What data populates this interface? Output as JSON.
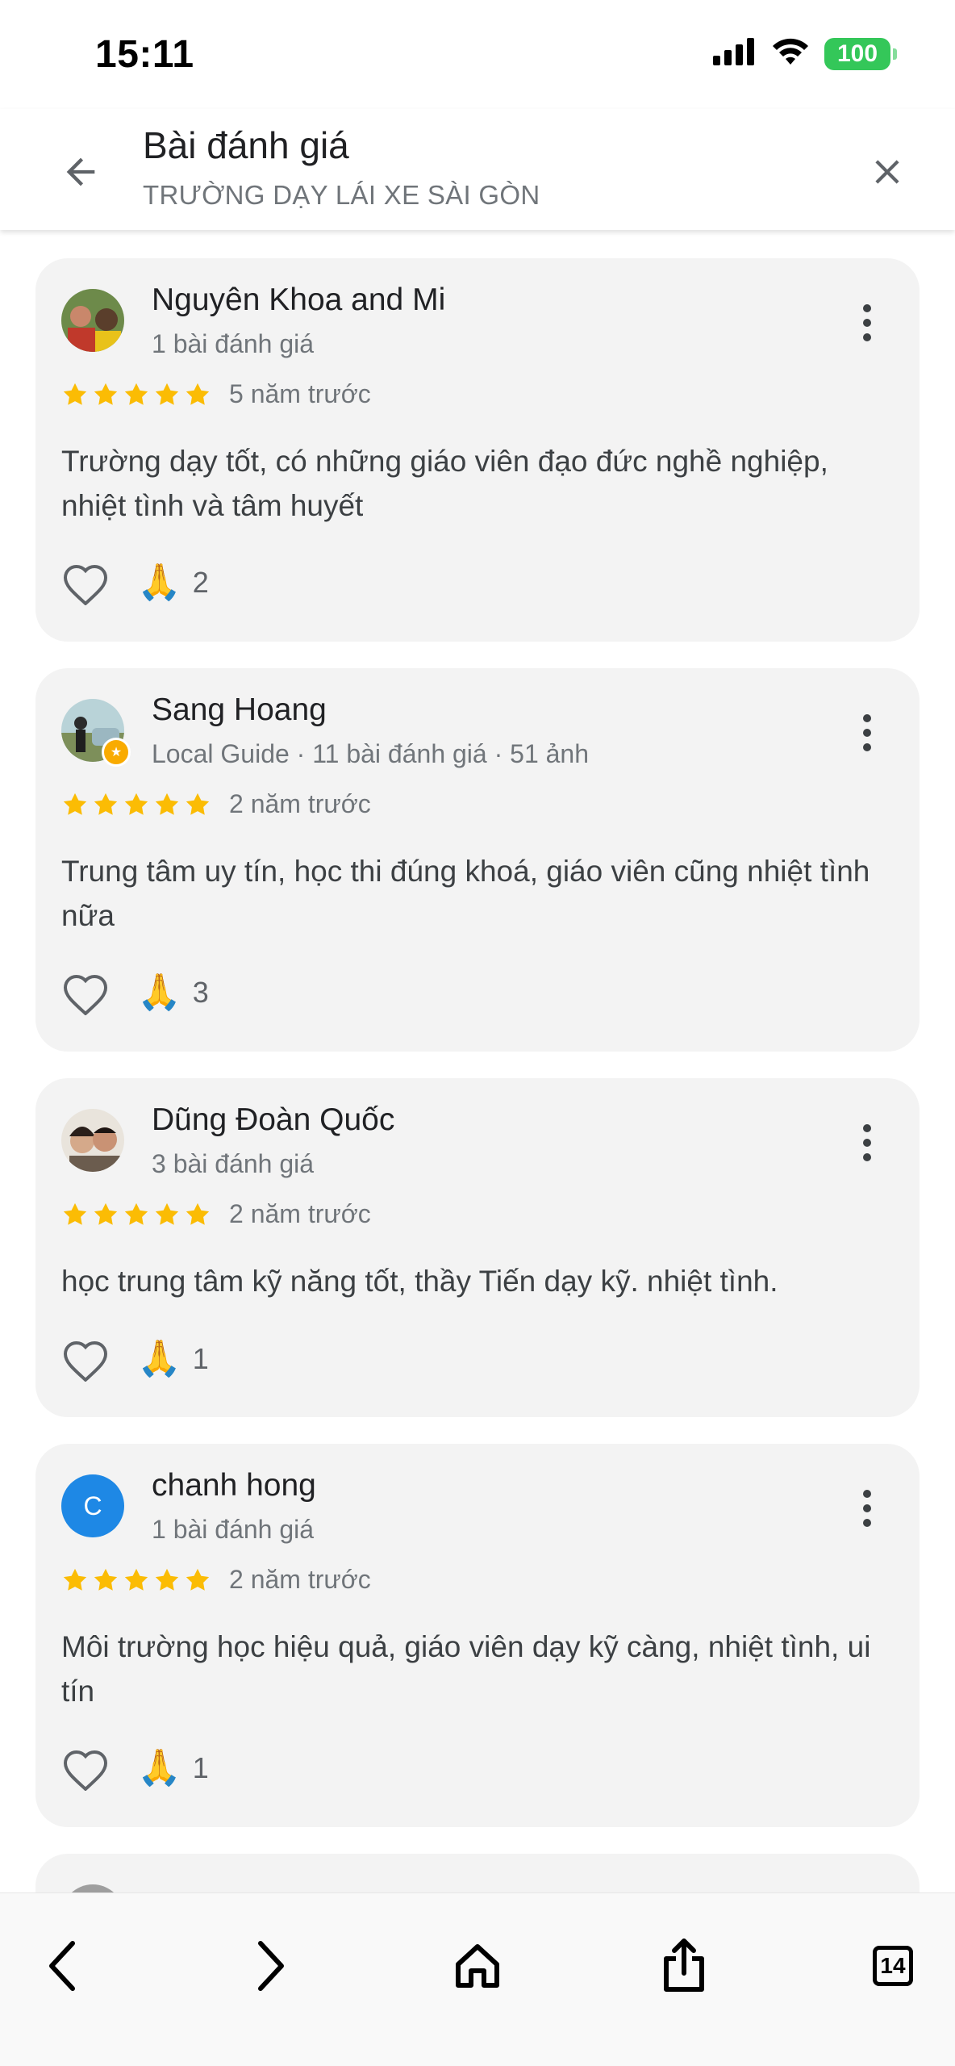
{
  "status_bar": {
    "time": "15:11",
    "battery": "100",
    "icons": [
      "signal-icon",
      "wifi-icon",
      "battery-icon"
    ],
    "battery_color": "#34c759"
  },
  "header": {
    "title": "Bài đánh giá",
    "subtitle": "TRƯỜNG DẠY LÁI XE SÀI GÒN",
    "back_icon": "arrow-back-icon",
    "close_icon": "close-icon"
  },
  "reviews": [
    {
      "name": "Nguyên Khoa and Mi",
      "meta": "1 bài đánh giá",
      "rating": 5,
      "time": "5 năm trước",
      "text": "Trường dạy tốt, có những giáo viên đạo đức nghề nghiệp, nhiệt tình và tâm huyết",
      "reactions": "2",
      "avatar_type": "photo",
      "local_guide": false
    },
    {
      "name": "Sang Hoang",
      "meta": "Local Guide · 11 bài đánh giá · 51 ảnh",
      "rating": 5,
      "time": "2 năm trước",
      "text": "Trung tâm uy tín, học thi đúng khoá, giáo viên cũng nhiệt tình nữa",
      "reactions": "3",
      "avatar_type": "photo",
      "local_guide": true
    },
    {
      "name": "Dũng Đoàn Quốc",
      "meta": "3 bài đánh giá",
      "rating": 5,
      "time": "2 năm trước",
      "text": "học trung tâm kỹ năng tốt, thầy Tiến dạy kỹ. nhiệt tình.",
      "reactions": "1",
      "avatar_type": "photo",
      "local_guide": false
    },
    {
      "name": "chanh hong",
      "meta": "1 bài đánh giá",
      "rating": 5,
      "time": "2 năm trước",
      "text": "Môi trường học hiệu quả, giáo viên dạy kỹ càng, nhiệt tình, ui tín",
      "reactions": "1",
      "avatar_type": "letter",
      "avatar_letter": "C",
      "local_guide": false
    }
  ],
  "colors": {
    "star": "#fbbc04",
    "card_bg": "#f3f3f3",
    "avatar_letter_bg": "#1e88e5"
  },
  "toolbar": {
    "tabs_count": "14",
    "icons": [
      "back-icon",
      "forward-icon",
      "home-icon",
      "share-icon",
      "tabs-icon"
    ]
  }
}
